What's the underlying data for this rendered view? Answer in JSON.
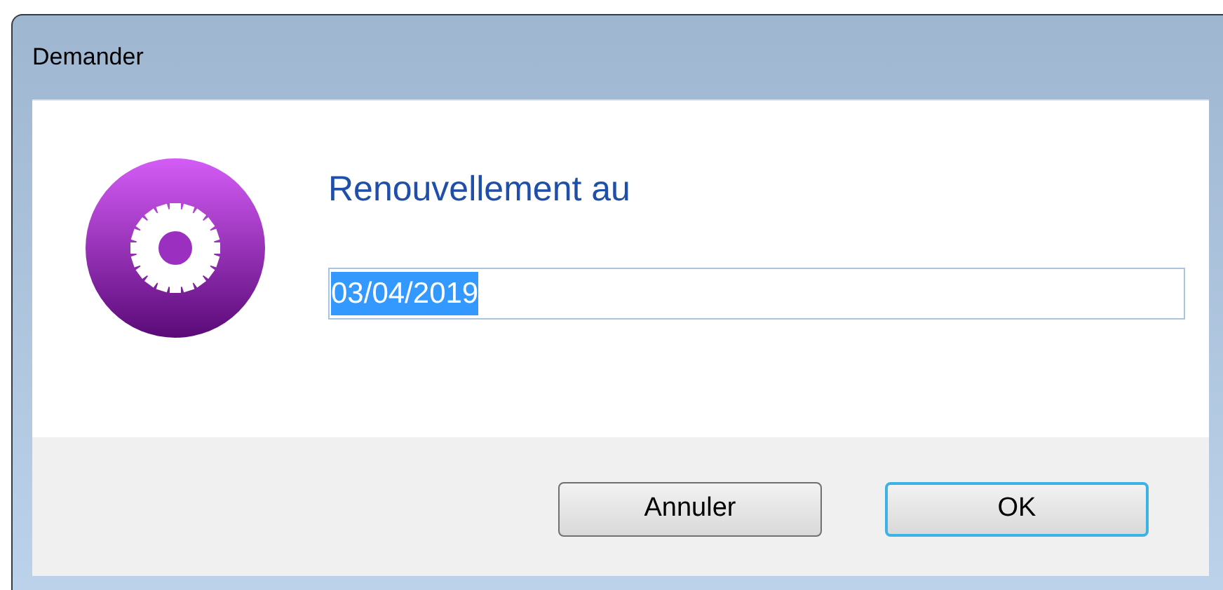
{
  "window": {
    "title": "Demander"
  },
  "prompt": "Renouvellement au",
  "field": {
    "value": "03/04/2019",
    "text_selected": true
  },
  "buttons": [
    {
      "label": "Annuler",
      "default": false
    },
    {
      "label": "OK",
      "default": true
    }
  ]
}
